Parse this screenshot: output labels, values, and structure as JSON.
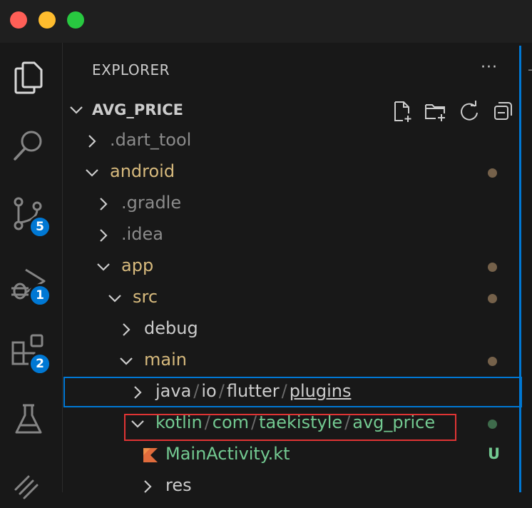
{
  "window": {
    "traffic_lights": [
      "close",
      "minimize",
      "zoom"
    ],
    "colors": {
      "close": "#ff5f57",
      "minimize": "#febc2e",
      "zoom": "#28c840"
    }
  },
  "activity_bar": {
    "items": [
      {
        "name": "explorer",
        "icon": "files-icon",
        "active": true
      },
      {
        "name": "search",
        "icon": "search-icon"
      },
      {
        "name": "source-control",
        "icon": "source-control-icon",
        "badge": "5"
      },
      {
        "name": "run-debug",
        "icon": "run-debug-icon",
        "badge": "1"
      },
      {
        "name": "extensions",
        "icon": "extensions-icon",
        "badge": "2"
      },
      {
        "name": "testing",
        "icon": "beaker-icon"
      },
      {
        "name": "remote",
        "icon": "remote-icon"
      }
    ]
  },
  "explorer": {
    "title": "EXPLORER",
    "more_label": "···",
    "root": "AVG_PRICE",
    "header_icons": [
      "new-file-icon",
      "new-folder-icon",
      "refresh-icon",
      "collapse-all-icon"
    ],
    "tree": [
      {
        "label": ".dart_tool",
        "expanded": false,
        "color": "#8b8b8b"
      },
      {
        "label": "android",
        "expanded": true,
        "color": "#d7ba7d",
        "dot": "#75614a"
      },
      {
        "label": ".gradle",
        "expanded": false,
        "color": "#8b8b8b"
      },
      {
        "label": ".idea",
        "expanded": false,
        "color": "#8b8b8b"
      },
      {
        "label": "app",
        "expanded": true,
        "color": "#d7ba7d",
        "dot": "#75614a"
      },
      {
        "label": "src",
        "expanded": true,
        "color": "#d7ba7d",
        "dot": "#75614a"
      },
      {
        "label": "debug",
        "expanded": false,
        "color": "#cccccc"
      },
      {
        "label": "main",
        "expanded": true,
        "color": "#d7ba7d",
        "dot": "#75614a"
      },
      {
        "parts": [
          "java",
          "io",
          "flutter",
          "plugins"
        ],
        "expanded": false,
        "color": "#cccccc",
        "focused": true
      },
      {
        "parts": [
          "kotlin",
          "com",
          "taekistyle",
          "avg_price"
        ],
        "expanded": true,
        "color": "#73c991",
        "dot": "#3e6b4b"
      },
      {
        "label": "MainActivity.kt",
        "file": true,
        "color": "#73c991",
        "status": "U"
      },
      {
        "label": "res",
        "expanded": false,
        "color": "#cccccc"
      }
    ]
  }
}
